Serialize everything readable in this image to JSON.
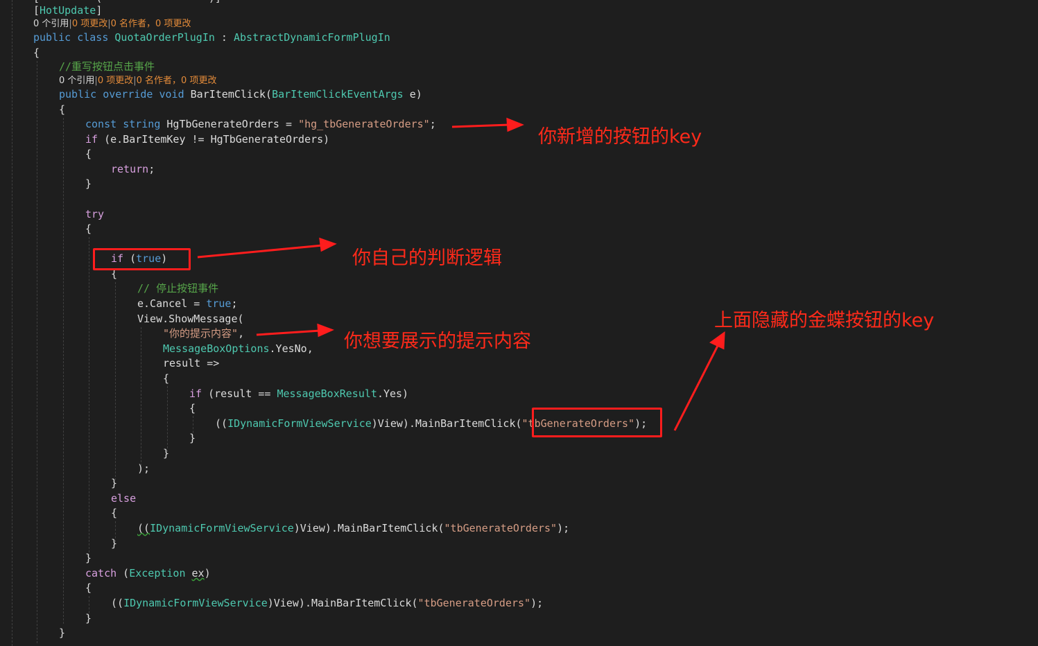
{
  "code": {
    "attr_partial": "[         (                 )]",
    "hot_update": "HotUpdate",
    "lens": {
      "class": {
        "refs": "0",
        "refs_label": " 个引用",
        "changes": "0",
        "changes_label": " 项更改",
        "authors": "0",
        "authors_label": " 名作者，",
        "authors_changes": "0",
        "authors_changes_label": " 项更改"
      },
      "method": {
        "refs": "0",
        "refs_label": " 个引用",
        "changes": "0",
        "changes_label": " 项更改",
        "authors": "0",
        "authors_label": " 名作者，",
        "authors_changes": "0",
        "authors_changes_label": " 项更改"
      }
    },
    "kw_public": "public",
    "kw_class": "class",
    "class_name": "QuotaOrderPlugIn",
    "colon": " : ",
    "base_class": "AbstractDynamicFormPlugIn",
    "brace_open": "{",
    "brace_close": "}",
    "comment_override": "//重写按钮点击事件",
    "kw_override": "override",
    "kw_void": "void",
    "method_name": "BarItemClick",
    "param_type": "BarItemClickEventArgs",
    "param_name": " e)",
    "kw_const": "const",
    "kw_string": "string",
    "const_name": " HgTbGenerateOrders = ",
    "const_value": "\"hg_tbGenerateOrders\"",
    "semicolon": ";",
    "kw_if": "if",
    "if_cond": " (e.BarItemKey != HgTbGenerateOrders)",
    "kw_return": "return",
    "kw_try": "try",
    "if_true_open": " (",
    "kw_true": "true",
    "paren_close": ")",
    "comment_stop": "// 停止按钮事件",
    "cancel_text": "e.Cancel = ",
    "show_message": "View.ShowMessage(",
    "message_text": "\"你的提示内容\"",
    "comma": ",",
    "msgbox_options": "MessageBoxOptions",
    "yesno": ".YesNo,",
    "result_lambda": "result =>",
    "result_cond_open": " (result == ",
    "msgbox_result": "MessageBoxResult",
    "yes_close": ".Yes)",
    "cast_open": "((",
    "iface": "IDynamicFormViewService",
    "cast_view": ")View).MainBarItemClick(",
    "order_key": "\"tbGenerateOrders\"",
    "call_close": ");",
    "close_paren_semi": ");",
    "kw_else": "else",
    "kw_catch": "catch",
    "catch_open": " (",
    "exception_type": "Exception",
    "ex_var": "ex"
  },
  "annotations": {
    "key_note": "你新增的按钮的key",
    "logic_note": "你自己的判断逻辑",
    "message_note": "你想要展示的提示内容",
    "hidden_key_note": "上面隐藏的金蝶按钮的key"
  },
  "colors": {
    "background": "#1e1e1e",
    "keyword": "#569cd6",
    "control_keyword": "#d8a0df",
    "type": "#4ec9b0",
    "string": "#d69d85",
    "comment": "#57a64a",
    "annotation": "#ff2a1a"
  }
}
